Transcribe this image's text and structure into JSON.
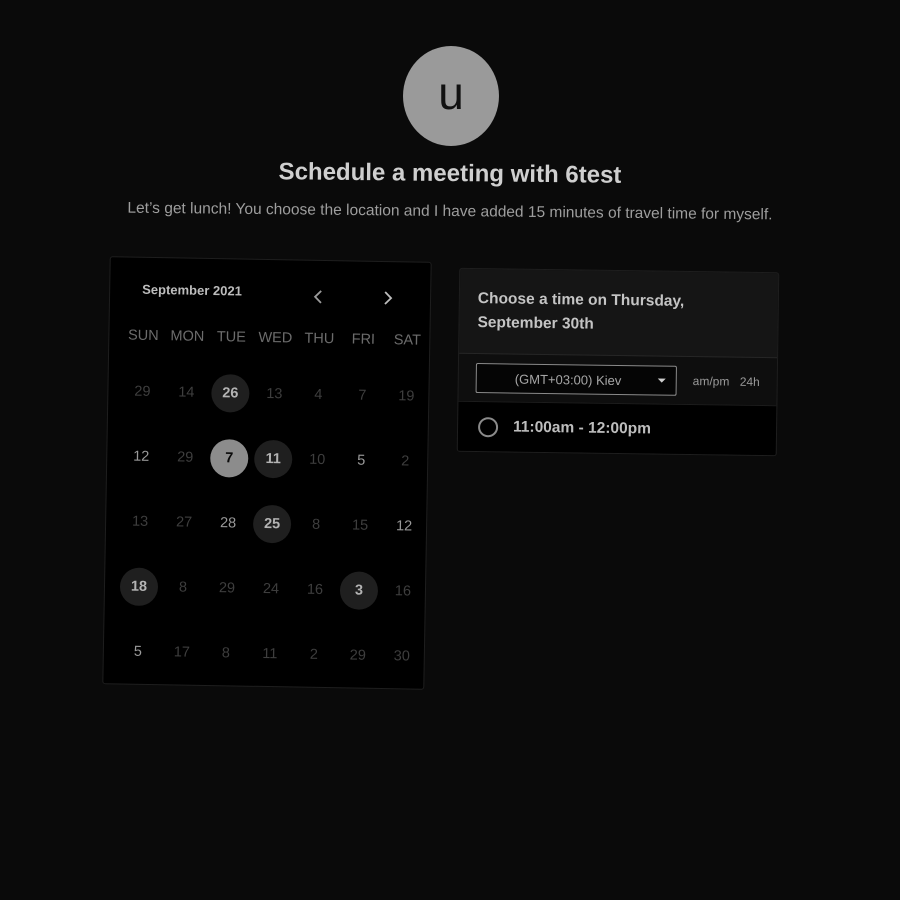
{
  "profile": {
    "avatar_letter": "u"
  },
  "header": {
    "title": "Schedule a meeting with 6test",
    "subtitle": "Let’s get lunch! You choose the location and I have added 15 minutes of travel time for myself."
  },
  "calendar": {
    "month_label": "September 2021",
    "prev_icon": "chevron-left-icon",
    "next_icon": "chevron-right-icon",
    "weekdays": [
      "SUN",
      "MON",
      "TUE",
      "WED",
      "THU",
      "FRI",
      "SAT"
    ],
    "weeks": [
      [
        {
          "d": "29",
          "s": "dim"
        },
        {
          "d": "14",
          "s": "dim"
        },
        {
          "d": "26",
          "s": "avail"
        },
        {
          "d": "13",
          "s": "dim"
        },
        {
          "d": "4",
          "s": "dim"
        },
        {
          "d": "7",
          "s": "dim"
        },
        {
          "d": "19",
          "s": "dim"
        }
      ],
      [
        {
          "d": "12",
          "s": "light"
        },
        {
          "d": "29",
          "s": "dim"
        },
        {
          "d": "7",
          "s": "selected"
        },
        {
          "d": "11",
          "s": "avail"
        },
        {
          "d": "10",
          "s": "dim"
        },
        {
          "d": "5",
          "s": "light"
        },
        {
          "d": "2",
          "s": "dim"
        }
      ],
      [
        {
          "d": "13",
          "s": "dim"
        },
        {
          "d": "27",
          "s": "dim"
        },
        {
          "d": "28",
          "s": "light"
        },
        {
          "d": "25",
          "s": "avail"
        },
        {
          "d": "8",
          "s": "dim"
        },
        {
          "d": "15",
          "s": "dim"
        },
        {
          "d": "12",
          "s": "light"
        }
      ],
      [
        {
          "d": "18",
          "s": "avail"
        },
        {
          "d": "8",
          "s": "dim"
        },
        {
          "d": "29",
          "s": "dim"
        },
        {
          "d": "24",
          "s": "dim"
        },
        {
          "d": "16",
          "s": "dim"
        },
        {
          "d": "3",
          "s": "avail"
        },
        {
          "d": "16",
          "s": "dim"
        }
      ],
      [
        {
          "d": "5",
          "s": "light"
        },
        {
          "d": "17",
          "s": "dim"
        },
        {
          "d": "8",
          "s": "dim"
        },
        {
          "d": "11",
          "s": "dim"
        },
        {
          "d": "2",
          "s": "dim"
        },
        {
          "d": "29",
          "s": "dim"
        },
        {
          "d": "30",
          "s": "dim"
        }
      ]
    ]
  },
  "time_picker": {
    "heading": "Choose a time on Thursday, September 30th",
    "timezone": "(GMT+03:00) Kiev",
    "format_ampm": "am/pm",
    "format_24h": "24h",
    "slots": [
      {
        "label": "11:00am - 12:00pm"
      }
    ]
  },
  "colors": {
    "background": "#0a0a0a",
    "available_day": "#1f1f1f",
    "selected_day": "#8c8c8c",
    "avatar": "#9a9a9a"
  }
}
